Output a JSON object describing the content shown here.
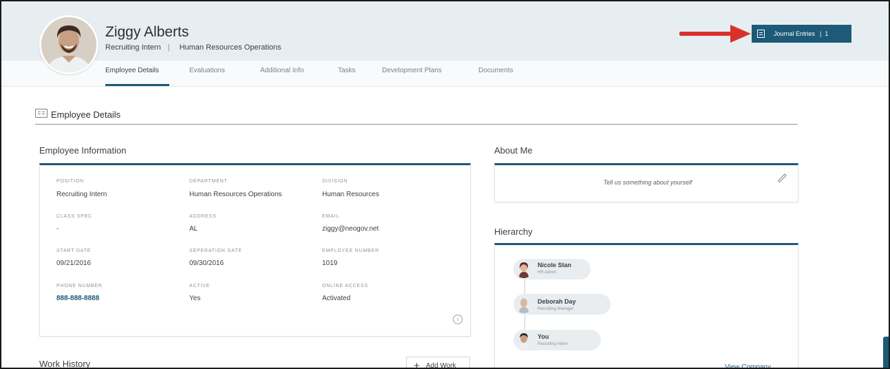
{
  "employee": {
    "name": "Ziggy Alberts",
    "position": "Recruiting Intern",
    "separator": "|",
    "department": "Human Resources Operations"
  },
  "tabs": [
    {
      "label": "Employee Details",
      "active": true
    },
    {
      "label": "Evaluations"
    },
    {
      "label": "Additional Info"
    },
    {
      "label": "Tasks"
    },
    {
      "label": "Development Plans"
    },
    {
      "label": "Documents"
    }
  ],
  "journal": {
    "label": "Journal Entries",
    "separator": "|",
    "count": "1"
  },
  "section": {
    "title": "Employee Details"
  },
  "employee_info": {
    "title": "Employee Information",
    "fields": [
      {
        "label": "POSITION",
        "value": "Recruiting Intern"
      },
      {
        "label": "DEPARTMENT",
        "value": "Human Resources Operations"
      },
      {
        "label": "DIVISION",
        "value": "Human Resources"
      },
      {
        "label": "CLASS SPEC",
        "value": "-"
      },
      {
        "label": "ADDRESS",
        "value": "AL"
      },
      {
        "label": "EMAIL",
        "value": "ziggy@neogov.net"
      },
      {
        "label": "START DATE",
        "value": "09/21/2016"
      },
      {
        "label": "SEPERATION DATE",
        "value": "09/30/2016"
      },
      {
        "label": "EMPLOYEE NUMBER",
        "value": "1019"
      },
      {
        "label": "PHONE NUMBER",
        "value": "888-888-8888"
      },
      {
        "label": "ACTIVE",
        "value": "Yes"
      },
      {
        "label": "ONLINE ACCESS",
        "value": "Activated"
      }
    ],
    "info_icon": "info-icon"
  },
  "about": {
    "title": "About Me",
    "placeholder": "Tell us something about yourself",
    "edit_icon": "pencil-icon"
  },
  "hierarchy": {
    "title": "Hierarchy",
    "people": [
      {
        "name": "Nicole Stan",
        "role": "HR Admin"
      },
      {
        "name": "Deborah Day",
        "role": "Recruiting Manager"
      },
      {
        "name": "You",
        "role": "Recruiting Intern"
      }
    ],
    "view_company": "View Company"
  },
  "work_history": {
    "title": "Work History",
    "add_label": "Add Work"
  },
  "colors": {
    "accent": "#1c5a78",
    "header_bg": "#e6eef2",
    "arrow": "#d9322b"
  }
}
